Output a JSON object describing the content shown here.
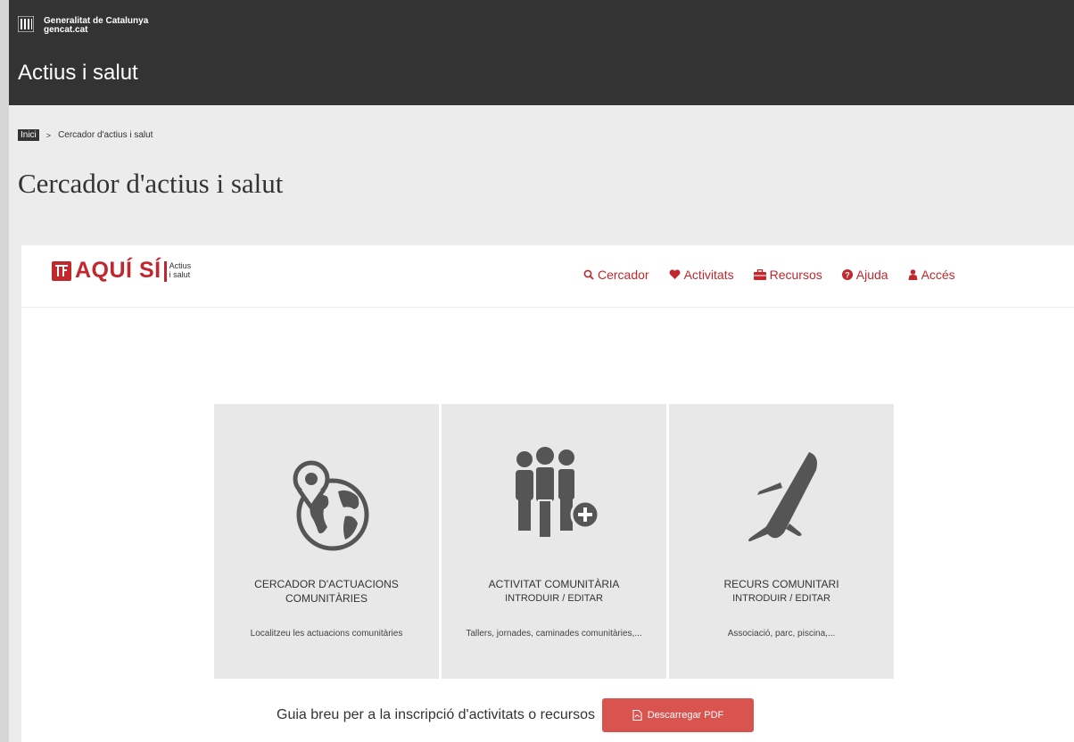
{
  "gov": {
    "brand_line1": "Generalitat de Catalunya",
    "brand_line2": "gencat.cat",
    "site_title": "Actius i salut"
  },
  "breadcrumb": {
    "home": "Inici",
    "separator": ">",
    "current": "Cercador d'actius i salut"
  },
  "page_title": "Cercador d'actius i salut",
  "app": {
    "logo": {
      "name": "AQUÍ SÍ",
      "sub1": "Actius",
      "sub2": "i salut"
    },
    "nav": [
      {
        "label": "Cercador",
        "icon": "search-icon"
      },
      {
        "label": "Activitats",
        "icon": "heart-icon"
      },
      {
        "label": "Recursos",
        "icon": "briefcase-icon"
      },
      {
        "label": "Ajuda",
        "icon": "question-icon"
      },
      {
        "label": "Accés",
        "icon": "user-icon"
      }
    ],
    "cards": [
      {
        "title": "CERCADOR D'ACTUACIONS COMUNITÀRIES",
        "subtitle": "",
        "description": "Localitzeu les actuacions comunitàries",
        "icon": "globe-pin-icon"
      },
      {
        "title": "ACTIVITAT COMUNITÀRIA",
        "subtitle": "INTRODUIR / EDITAR",
        "description": "Tallers, jornades, caminades comunitàries,...",
        "icon": "people-add-icon"
      },
      {
        "title": "RECURS COMUNITARI",
        "subtitle": "INTRODUIR / EDITAR",
        "description": "Associació, parc, piscina,...",
        "icon": "knife-icon"
      }
    ],
    "guide_text": "Guia breu per a la inscripció d'activitats o recursos",
    "pdf_button": "Descarregar PDF"
  },
  "colors": {
    "accent": "#c1272d",
    "header": "#333333",
    "button": "#d9534f"
  }
}
